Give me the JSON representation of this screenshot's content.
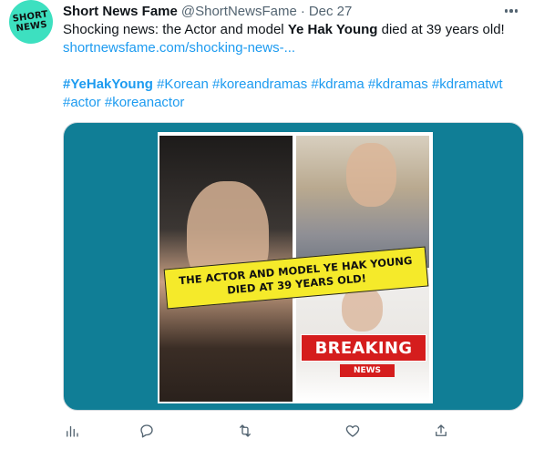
{
  "tweet": {
    "author_name": "Short News Fame",
    "author_handle": "@ShortNewsFame",
    "separator": "·",
    "date": "Dec 27",
    "avatar_text": [
      "SHORT",
      "NEWS"
    ],
    "text_prefix": "Shocking news: the Actor and model ",
    "text_bold": "Ye Hak Young",
    "text_suffix": " died at 39 years old!",
    "link": "shortnewsfame.com/shocking-news-...",
    "hashtags_line1": [
      {
        "text": "#YeHakYoung",
        "bold": true
      },
      {
        "text": "#Korean",
        "bold": false
      },
      {
        "text": "#koreandramas",
        "bold": false
      },
      {
        "text": "#kdrama",
        "bold": false
      },
      {
        "text": "#kdramas",
        "bold": false
      },
      {
        "text": "#kdramatwt",
        "bold": false
      }
    ],
    "hashtags_line2": [
      {
        "text": "#actor",
        "bold": false
      },
      {
        "text": "#koreanactor",
        "bold": false
      }
    ]
  },
  "media": {
    "banner_line1": "THE ACTOR AND MODEL YE HAK YOUNG",
    "banner_line2": "DIED AT 39 YEARS OLD!",
    "breaking_label": "BREAKING",
    "news_label": "NEWS",
    "background_color": "#107e96",
    "banner_color": "#f5ea2a",
    "breaking_color": "#d51d1d"
  },
  "actions": [
    {
      "icon": "analytics-icon"
    },
    {
      "icon": "reply-icon"
    },
    {
      "icon": "retweet-icon"
    },
    {
      "icon": "like-icon"
    },
    {
      "icon": "share-icon"
    }
  ],
  "colors": {
    "link": "#1d9bf0",
    "muted": "#536471",
    "avatar": "#3de0c0"
  }
}
